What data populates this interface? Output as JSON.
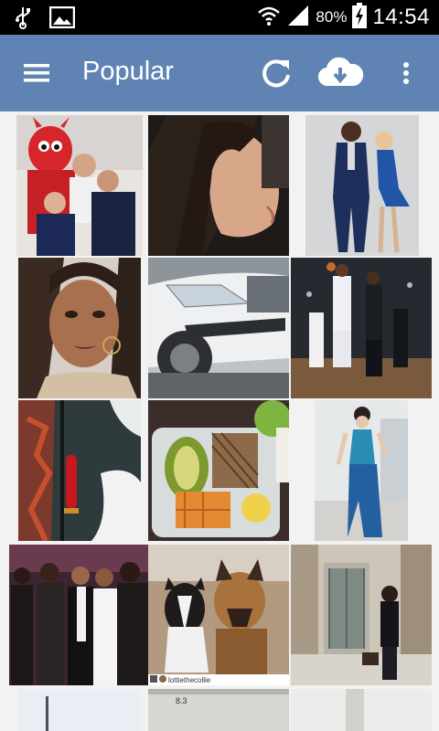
{
  "status_bar": {
    "battery_percent": "80%",
    "time": "14:54",
    "icons": [
      "usb-icon",
      "image-icon",
      "wifi-icon",
      "signal-icon",
      "battery-charging-icon"
    ]
  },
  "app_bar": {
    "title": "Popular",
    "icons": [
      "menu-icon",
      "refresh-icon",
      "cloud-download-icon",
      "more-vert-icon"
    ],
    "color": "#5f84b3"
  },
  "grid": {
    "tiles": [
      {
        "subject": "mascot-and-fans-photo"
      },
      {
        "subject": "woman-profile-photo"
      },
      {
        "subject": "dancing-couple-photo"
      },
      {
        "subject": "woman-selfie-photo"
      },
      {
        "subject": "white-car-photo"
      },
      {
        "subject": "basketball-game-photo"
      },
      {
        "subject": "painted-wall-photo"
      },
      {
        "subject": "meal-prep-photo"
      },
      {
        "subject": "woman-posing-photo"
      },
      {
        "subject": "group-party-photo",
        "caption": ""
      },
      {
        "subject": "two-dogs-photo",
        "caption": "lottiethecollie"
      },
      {
        "subject": "woman-street-photo"
      },
      {
        "subject": "partial-tile-1"
      },
      {
        "subject": "partial-tile-2",
        "caption": "8.3"
      },
      {
        "subject": "partial-tile-3"
      }
    ]
  }
}
